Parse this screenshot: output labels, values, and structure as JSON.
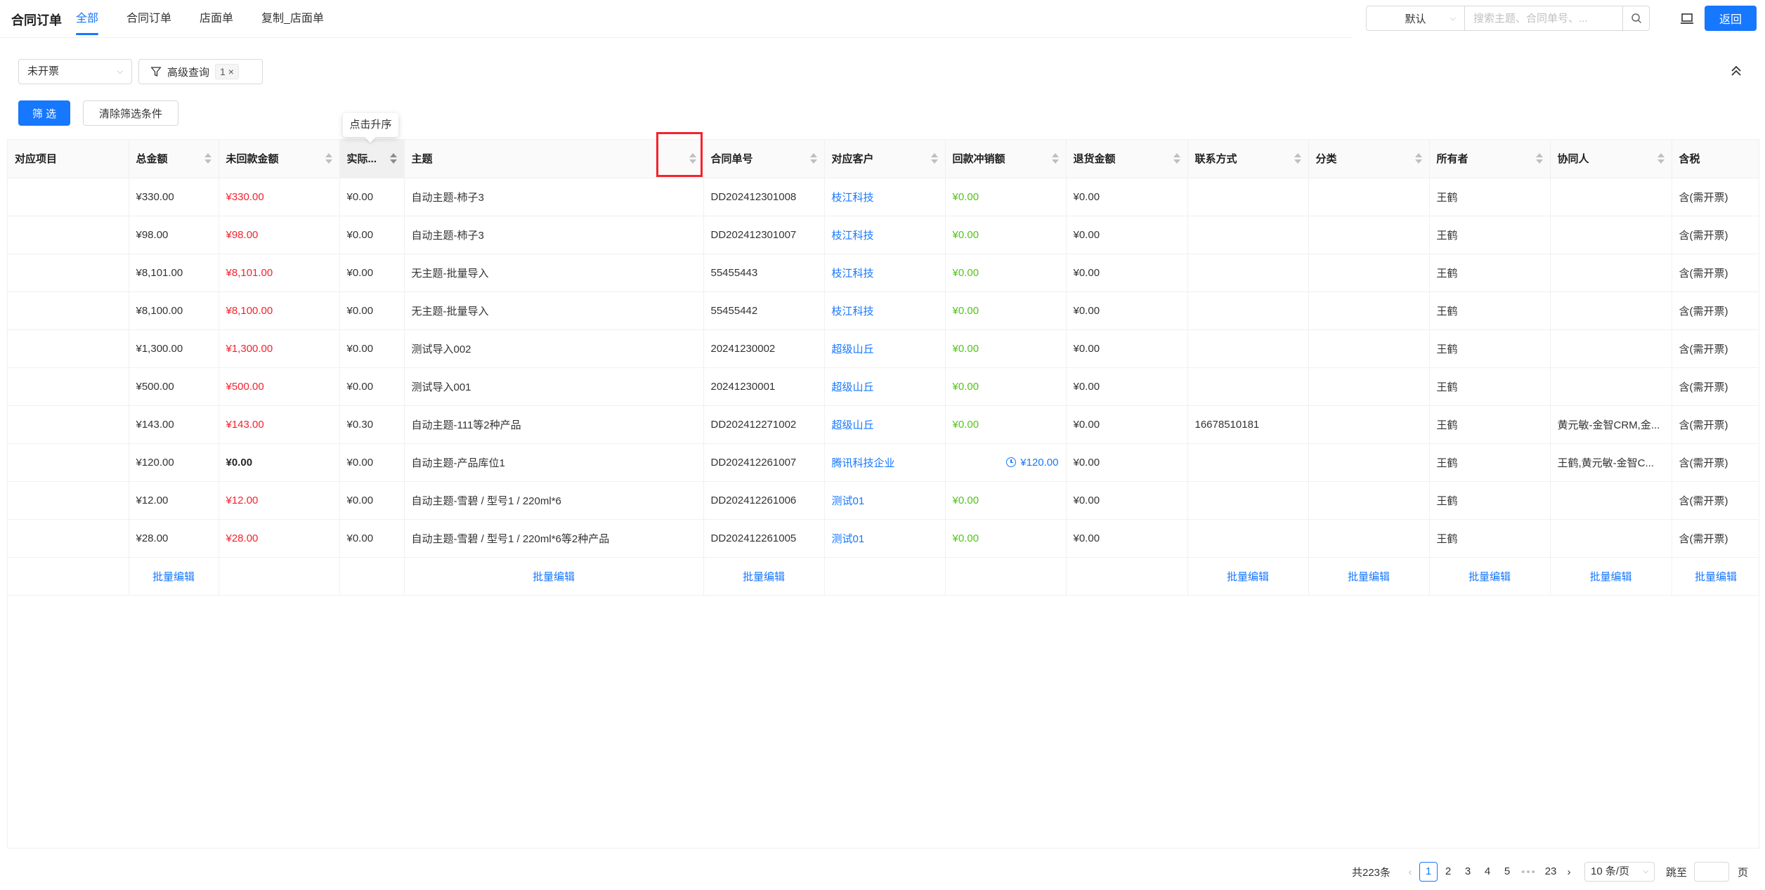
{
  "header": {
    "title": "合同订单",
    "tabs": [
      {
        "label": "全部",
        "active": true
      },
      {
        "label": "合同订单",
        "active": false
      },
      {
        "label": "店面单",
        "active": false
      },
      {
        "label": "复制_店面单",
        "active": false
      }
    ],
    "view_select": "默认",
    "search_placeholder": "搜索主题、合同单号、...",
    "back_label": "返回"
  },
  "filters": {
    "status_select": "未开票",
    "advanced_label": "高级查询",
    "advanced_count": "1 ×",
    "filter_button": "筛 选",
    "clear_button": "清除筛选条件"
  },
  "tooltip": "点击升序",
  "table": {
    "columns": [
      "对应项目",
      "总金额",
      "未回款金额",
      "实际...",
      "主题",
      "合同单号",
      "对应客户",
      "回款冲销额",
      "退货金额",
      "联系方式",
      "分类",
      "所有者",
      "协同人",
      "含税"
    ],
    "rows": [
      {
        "project": "",
        "total": "¥330.00",
        "unpaid": "¥330.00",
        "actual": "¥0.00",
        "subject": "自动主题-柿子3",
        "order_no": "DD202412301008",
        "customer": "枝江科技",
        "writeoff": "¥0.00",
        "return_amt": "¥0.00",
        "contact": "",
        "category": "",
        "owner": "王鹤",
        "collaborator": "",
        "tax": "含(需开票)"
      },
      {
        "project": "",
        "total": "¥98.00",
        "unpaid": "¥98.00",
        "actual": "¥0.00",
        "subject": "自动主题-柿子3",
        "order_no": "DD202412301007",
        "customer": "枝江科技",
        "writeoff": "¥0.00",
        "return_amt": "¥0.00",
        "contact": "",
        "category": "",
        "owner": "王鹤",
        "collaborator": "",
        "tax": "含(需开票)"
      },
      {
        "project": "",
        "total": "¥8,101.00",
        "unpaid": "¥8,101.00",
        "actual": "¥0.00",
        "subject": "无主题-批量导入",
        "order_no": "55455443",
        "customer": "枝江科技",
        "writeoff": "¥0.00",
        "return_amt": "¥0.00",
        "contact": "",
        "category": "",
        "owner": "王鹤",
        "collaborator": "",
        "tax": "含(需开票)"
      },
      {
        "project": "",
        "total": "¥8,100.00",
        "unpaid": "¥8,100.00",
        "actual": "¥0.00",
        "subject": "无主题-批量导入",
        "order_no": "55455442",
        "customer": "枝江科技",
        "writeoff": "¥0.00",
        "return_amt": "¥0.00",
        "contact": "",
        "category": "",
        "owner": "王鹤",
        "collaborator": "",
        "tax": "含(需开票)"
      },
      {
        "project": "",
        "total": "¥1,300.00",
        "unpaid": "¥1,300.00",
        "actual": "¥0.00",
        "subject": "测试导入002",
        "order_no": "20241230002",
        "customer": "超级山丘",
        "writeoff": "¥0.00",
        "return_amt": "¥0.00",
        "contact": "",
        "category": "",
        "owner": "王鹤",
        "collaborator": "",
        "tax": "含(需开票)"
      },
      {
        "project": "",
        "total": "¥500.00",
        "unpaid": "¥500.00",
        "actual": "¥0.00",
        "subject": "测试导入001",
        "order_no": "20241230001",
        "customer": "超级山丘",
        "writeoff": "¥0.00",
        "return_amt": "¥0.00",
        "contact": "",
        "category": "",
        "owner": "王鹤",
        "collaborator": "",
        "tax": "含(需开票)"
      },
      {
        "project": "",
        "total": "¥143.00",
        "unpaid": "¥143.00",
        "actual": "¥0.30",
        "subject": "自动主题-111等2种产品",
        "order_no": "DD202412271002",
        "customer": "超级山丘",
        "writeoff": "¥0.00",
        "return_amt": "¥0.00",
        "contact": "16678510181",
        "category": "",
        "owner": "王鹤",
        "collaborator": "黄元敏-金智CRM,金...",
        "tax": "含(需开票)"
      },
      {
        "project": "",
        "total": "¥120.00",
        "unpaid": "¥0.00",
        "actual": "¥0.00",
        "subject": "自动主题-产品库位1",
        "order_no": "DD202412261007",
        "customer": "腾讯科技企业",
        "writeoff": "¥120.00",
        "return_amt": "¥0.00",
        "contact": "",
        "category": "",
        "owner": "王鹤",
        "collaborator": "王鹤,黄元敏-金智C...",
        "tax": "含(需开票)"
      },
      {
        "project": "",
        "total": "¥12.00",
        "unpaid": "¥12.00",
        "actual": "¥0.00",
        "subject": "自动主题-雪碧 / 型号1 / 220ml*6",
        "order_no": "DD202412261006",
        "customer": "测试01",
        "writeoff": "¥0.00",
        "return_amt": "¥0.00",
        "contact": "",
        "category": "",
        "owner": "王鹤",
        "collaborator": "",
        "tax": "含(需开票)"
      },
      {
        "project": "",
        "total": "¥28.00",
        "unpaid": "¥28.00",
        "actual": "¥0.00",
        "subject": "自动主题-雪碧 / 型号1 / 220ml*6等2种产品",
        "order_no": "DD202412261005",
        "customer": "测试01",
        "writeoff": "¥0.00",
        "return_amt": "¥0.00",
        "contact": "",
        "category": "",
        "owner": "王鹤",
        "collaborator": "",
        "tax": "含(需开票)"
      }
    ],
    "batch_edit_label": "批量编辑"
  },
  "pagination": {
    "total": "共223条",
    "pages": [
      "1",
      "2",
      "3",
      "4",
      "5"
    ],
    "ellipsis": "•••",
    "last_page": "23",
    "page_size": "10 条/页",
    "jump_label": "跳至",
    "jump_suffix": "页"
  },
  "colors": {
    "primary": "#1677ff",
    "danger": "#f5222d",
    "success": "#52c41a"
  }
}
